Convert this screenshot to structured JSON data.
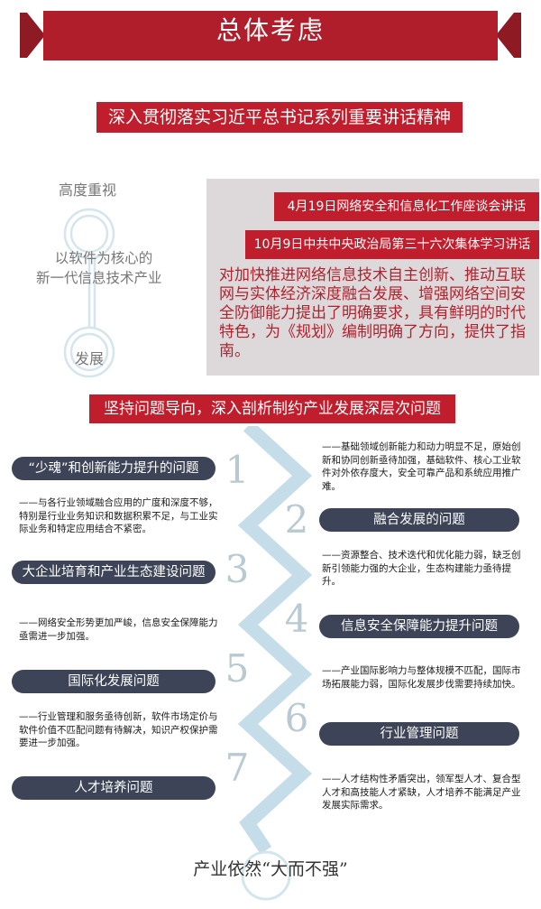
{
  "header": {
    "title": "总体考虑"
  },
  "subtitle": "深入贯彻落实习近平总书记系列重要讲话精神",
  "left_panel": {
    "top": "高度重视",
    "middle_line1": "以软件为核心的",
    "middle_line2": "新一代信息技术产业",
    "bottom": "发展"
  },
  "meetings": {
    "date1": "4月19日网络安全和信息化工作座谈会讲话",
    "date2": "10月9日中共中央政治局第三十六次集体学习讲话",
    "paragraph": "对加快推进网络信息技术自主创新、推动互联网与实体经济深度融合发展、增强网络空间安全防御能力提出了明确要求，具有鲜明的时代特色，为《规划》编制明确了方向，提供了指南。"
  },
  "section2": {
    "title": "坚持问题导向，深入剖析制约产业发展深层次问题"
  },
  "problems": [
    {
      "number": "1",
      "pill": "“少魂”和创新能力提升的问题",
      "desc": "——基础领域创新能力和动力明显不足，原始创新和协同创新亟待加强，基础软件、核心工业软件对外依存度大，安全可靠产品和系统应用推广难。"
    },
    {
      "number": "2",
      "pill": "融合发展的问题",
      "desc": "——与各行业领域融合应用的广度和深度不够，特别是行业业务知识和数据积累不足，与工业实际业务和特定应用结合不紧密。"
    },
    {
      "number": "3",
      "pill": "大企业培育和产业生态建设问题",
      "desc": "——资源整合、技术迭代和优化能力弱，缺乏创新引领能力强的大企业，生态构建能力亟待提升。"
    },
    {
      "number": "4",
      "pill": "信息安全保障能力提升问题",
      "desc": "——网络安全形势更加严峻，信息安全保障能力亟需进一步加强。"
    },
    {
      "number": "5",
      "pill": "国际化发展问题",
      "desc": "——产业国际影响力与整体规模不匹配，国际市场拓展能力弱，国际化发展步伐需要持续加快。"
    },
    {
      "number": "6",
      "pill": "行业管理问题",
      "desc": "——行业管理和服务亟待创新，软件市场定价与软件价值不匹配问题有待解决，知识产权保护需要进一步加强。"
    },
    {
      "number": "7",
      "pill": "人才培养问题",
      "desc": "——人才结构性矛盾突出，领军型人才、复合型人才和高技能人才紧缺，人才培养不能满足产业发展实际需求。"
    }
  ],
  "footer": {
    "text": "产业依然“大而不强”"
  },
  "colors": {
    "red": "#c01e2c",
    "navy": "#3e4457",
    "gray_box": "#ddd8da",
    "zigzag": "#c5dde9"
  }
}
